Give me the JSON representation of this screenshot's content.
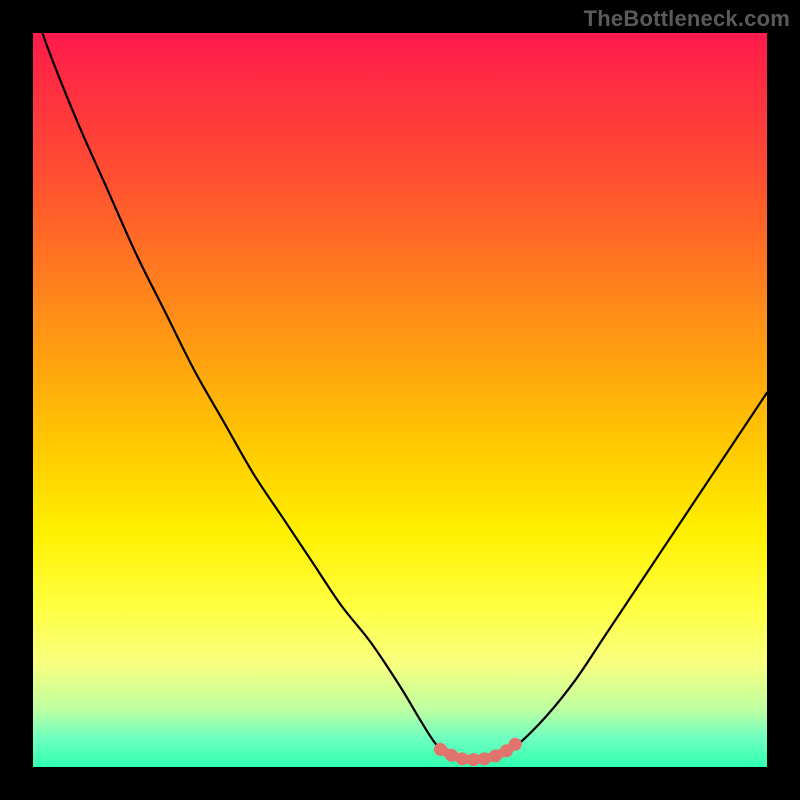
{
  "watermark": "TheBottleneck.com",
  "colors": {
    "background": "#000000",
    "curve": "#000000",
    "marker": "#e2746e",
    "gradient_top": "#ff1a4d",
    "gradient_bottom": "#30ffb0"
  },
  "chart_data": {
    "type": "line",
    "title": "",
    "xlabel": "",
    "ylabel": "",
    "xlim": [
      0,
      100
    ],
    "ylim": [
      0,
      100
    ],
    "x": [
      0,
      2,
      6,
      10,
      14,
      18,
      22,
      26,
      30,
      34,
      38,
      42,
      46,
      50,
      53,
      55,
      57,
      58.5,
      60,
      62,
      64,
      66,
      70,
      74,
      78,
      82,
      86,
      90,
      94,
      98,
      100
    ],
    "values": [
      104,
      98,
      88,
      79,
      70,
      62,
      54,
      47,
      40,
      34,
      28,
      22,
      17,
      11,
      6,
      3,
      1.5,
      1,
      1,
      1.2,
      1.8,
      3,
      7,
      12,
      18,
      24,
      30,
      36,
      42,
      48,
      51
    ],
    "marker_points": {
      "x": [
        55.5,
        57,
        58.5,
        60,
        61.5,
        63,
        64.5,
        65.7
      ],
      "y": [
        2.4,
        1.6,
        1.1,
        1.0,
        1.1,
        1.5,
        2.2,
        3.1
      ]
    },
    "note": "x and y are in percent of plot area; y=0 is bottom, values may exceed 100 where the curve exits the top edge"
  }
}
